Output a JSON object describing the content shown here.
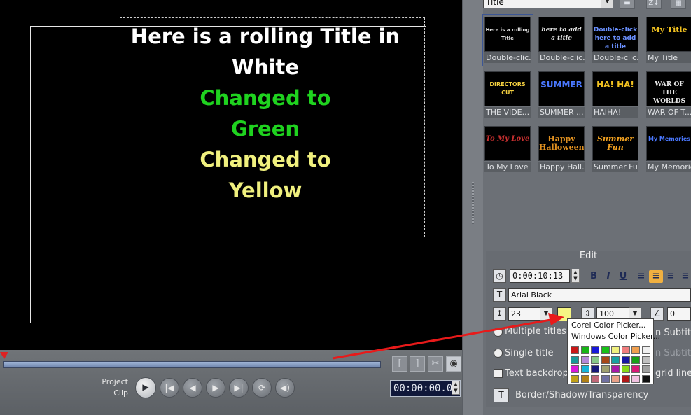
{
  "preview": {
    "title_lines": [
      {
        "text": "Here is a rolling Title in",
        "color": "#ffffff"
      },
      {
        "text": "White",
        "color": "#ffffff"
      },
      {
        "text": "Changed to",
        "color": "#1fd21f"
      },
      {
        "text": "Green",
        "color": "#1fd21f"
      },
      {
        "text": "Changed to",
        "color": "#f0f07e"
      },
      {
        "text": "Yellow",
        "color": "#f0f07e"
      }
    ]
  },
  "playback": {
    "project_label": "Project",
    "clip_label": "Clip",
    "timecode": "00:00:00.00"
  },
  "library": {
    "category": "Title",
    "thumbnails": [
      {
        "caption": "Double-clic...",
        "preview_text": "Here is a rolling Title"
      },
      {
        "caption": "Double-clic...",
        "preview_text": "here to add a title"
      },
      {
        "caption": "Double-clic...",
        "preview_text": "Double-click here to add a title"
      },
      {
        "caption": "My Title",
        "preview_text": "My Title"
      },
      {
        "caption": "THE VIDE...",
        "preview_text": "DIRECTORS CUT"
      },
      {
        "caption": "SUMMER ...",
        "preview_text": "SUMMER"
      },
      {
        "caption": "HAIHA!",
        "preview_text": "HA! HA!"
      },
      {
        "caption": "WAR OF T...",
        "preview_text": "WAR OF THE WORLDS"
      },
      {
        "caption": "To My Love",
        "preview_text": "To My Love"
      },
      {
        "caption": "Happy Hall...",
        "preview_text": "Happy Halloween"
      },
      {
        "caption": "Summer Fun",
        "preview_text": "Summer Fun"
      },
      {
        "caption": "My Memories",
        "preview_text": "My Memories"
      }
    ]
  },
  "edit": {
    "header": "Edit",
    "duration": "0:00:10:13",
    "font_name": "Arial Black",
    "font_size": "23",
    "line_spacing": "100",
    "angle": "0",
    "text_color": "#f5f583",
    "options": {
      "multiple_titles": "Multiple titles",
      "single_title": "Single title",
      "text_backdrop": "Text backdrop",
      "subtitle_1": "n Subtitle",
      "subtitle_2": "n Subtitle",
      "grid_lines": "grid lines",
      "border_shadow": "Border/Shadow/Transparency"
    }
  },
  "color_menu": {
    "corel_picker": "Corel Color Picker...",
    "windows_picker": "Windows Color Picker...",
    "swatches": [
      [
        "#c81818",
        "#18b418",
        "#1818d8",
        "#18c018",
        "#f0f07e",
        "#f07e7e",
        "#f0a050",
        "#f0f0f0"
      ],
      [
        "#189898",
        "#b488d8",
        "#88c888",
        "#a84818",
        "#18a0a0",
        "#1818a0",
        "#18a018",
        "#c0c0c0"
      ],
      [
        "#d818d8",
        "#18b4d8",
        "#181878",
        "#a0a070",
        "#a818a8",
        "#88d818",
        "#d81878",
        "#a0a0a0"
      ],
      [
        "#c0a018",
        "#b08018",
        "#c06878",
        "#7070a0",
        "#e8a088",
        "#b01818",
        "#f0c0e0",
        "#101010"
      ]
    ]
  }
}
